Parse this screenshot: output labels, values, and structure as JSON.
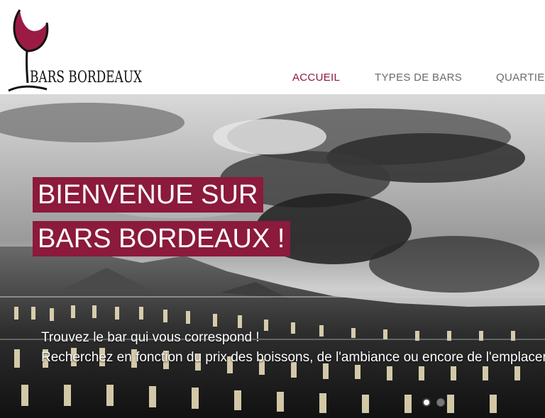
{
  "brand": {
    "name": "BARS BORDEAUX",
    "accent_color": "#8b1a3c",
    "logo_icon": "wine-glass-icon"
  },
  "nav": {
    "items": [
      {
        "label": "ACCUEIL",
        "active": true
      },
      {
        "label": "TYPES DE BARS",
        "active": false
      },
      {
        "label": "QUARTIERS",
        "active": false
      }
    ]
  },
  "hero": {
    "title_line1": "BIENVENUE SUR",
    "title_line2": "BARS BORDEAUX !",
    "tagline1": "Trouvez le bar qui vous correspond !",
    "tagline2": "Recherchez en fonction du prix des boissons, de l'ambiance ou encore de l'emplacement",
    "slides": {
      "current": 1,
      "total": 2
    }
  }
}
